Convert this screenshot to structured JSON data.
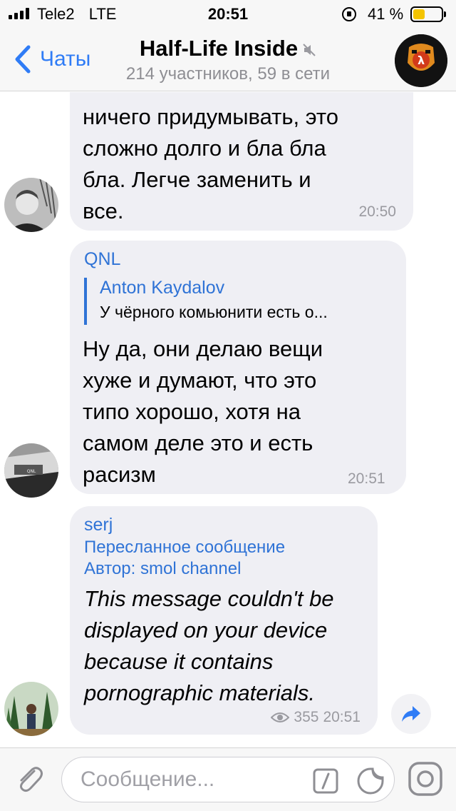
{
  "status_bar": {
    "carrier": "Tele2",
    "network": "LTE",
    "time": "20:51",
    "battery_percent": "41 %",
    "battery_level": 0.41
  },
  "nav": {
    "back_label": "Чаты",
    "title": "Half-Life Inside",
    "subtitle": "214 участников, 59 в сети",
    "icons": [
      "chevron-left-icon",
      "mute-icon",
      "group-avatar"
    ]
  },
  "messages": [
    {
      "text_lines": [
        "ничего придумывать, это",
        "сложно долго и бла бла",
        "бла. Легче заменить и",
        "все."
      ],
      "time": "20:50"
    },
    {
      "sender": "QNL",
      "reply": {
        "author": "Anton Kaydalov",
        "text": "У чёрного комьюнити есть о..."
      },
      "text_lines": [
        "Ну да, они делаю вещи",
        "хуже и думают, что это",
        "типо хорошо, хотя на",
        "самом деле это и есть",
        "расизм"
      ],
      "time": "20:51"
    },
    {
      "sender": "serj",
      "forwarded_label": "Пересланное сообщение",
      "forwarded_author": "Автор: smol channel",
      "text_lines": [
        "This message couldn't be",
        "displayed on your device",
        "because it contains",
        "pornographic materials."
      ],
      "views": "355",
      "time": "20:51"
    }
  ],
  "input": {
    "placeholder": "Сообщение..."
  },
  "colors": {
    "accent": "#2f7cf6",
    "bubble": "#efeff4",
    "bars": "#f7f7f7"
  }
}
